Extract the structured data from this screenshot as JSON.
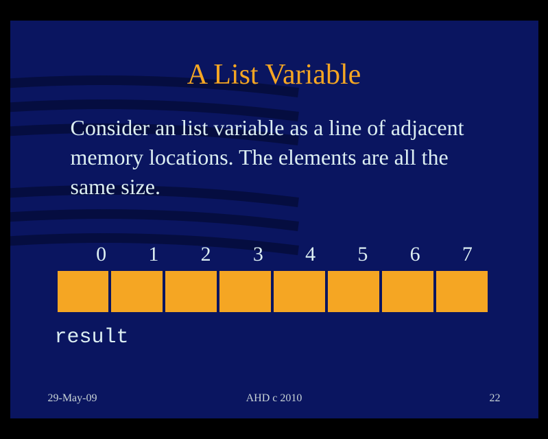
{
  "title": "A List Variable",
  "body": "Consider an list variable as a line of adjacent memory locations.  The elements are all the same size.",
  "indices": [
    "0",
    "1",
    "2",
    "3",
    "4",
    "5",
    "6",
    "7"
  ],
  "varName": "result",
  "footer": {
    "left": "29-May-09",
    "center": "AHD  c  2010",
    "right": "22"
  }
}
